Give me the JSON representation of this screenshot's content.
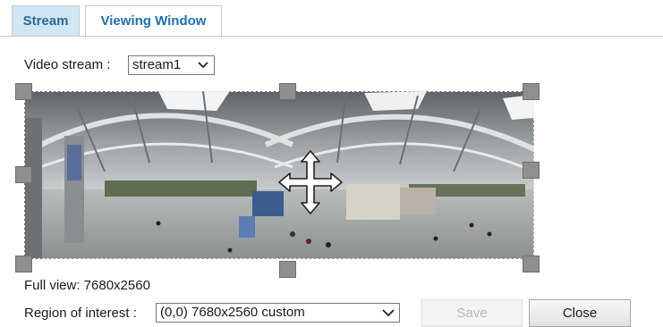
{
  "tabs": [
    {
      "label": "Stream",
      "active": false
    },
    {
      "label": "Viewing Window",
      "active": true
    }
  ],
  "video_stream": {
    "label": "Video stream :",
    "value": "stream1"
  },
  "full_view": {
    "label": "Full view: 7680x2560"
  },
  "region_of_interest": {
    "label": "Region of interest :",
    "value": "(0,0) 7680x2560 custom"
  },
  "buttons": {
    "save_label": "Save",
    "save_enabled": false,
    "close_label": "Close"
  },
  "icons": {
    "move": "move-arrows-icon",
    "dropdown": "chevron-down-icon"
  },
  "colors": {
    "tab_active_text": "#1f6fb1",
    "tab_inactive_bg": "#cfe6f3",
    "handle": "#8f8f8f"
  }
}
